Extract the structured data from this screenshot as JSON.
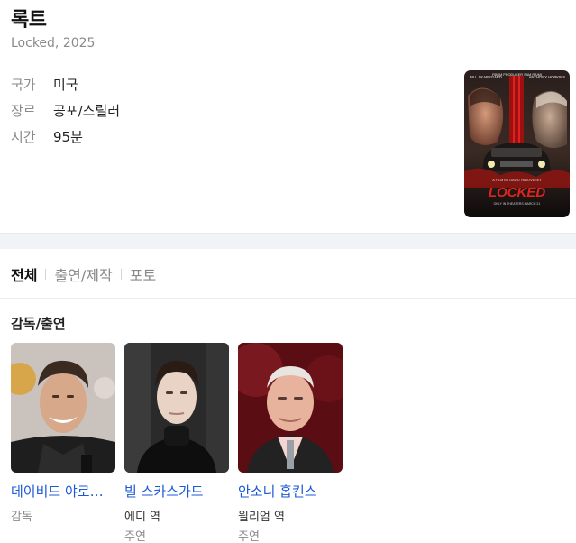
{
  "movie": {
    "title": "록트",
    "subtitle": "Locked, 2025",
    "info": [
      {
        "key": "국가",
        "value": "미국"
      },
      {
        "key": "장르",
        "value": "공포/스릴러"
      },
      {
        "key": "시간",
        "value": "95분"
      }
    ],
    "poster": {
      "big_title": "LOCKED",
      "credit_left": "BILL SKARSGÅRD",
      "credit_center": "FROM PRODUCER SAM RAIMI",
      "credit_right": "ANTHONY HOPKINS",
      "director_line": "A FILM BY DAVID YAROVESKY",
      "tagline": "ONLY IN THEATERS MARCH 21"
    }
  },
  "tabs": [
    {
      "label": "전체",
      "active": true
    },
    {
      "label": "출연/제작",
      "active": false
    },
    {
      "label": "포토",
      "active": false
    }
  ],
  "section": {
    "title": "감독/출연"
  },
  "cast": [
    {
      "name": "데이비드 야로베스키",
      "role": "감독",
      "kind": ""
    },
    {
      "name": "빌 스카스가드",
      "role": "에디 역",
      "kind": "주연"
    },
    {
      "name": "안소니 홉킨스",
      "role": "윌리엄 역",
      "kind": "주연"
    }
  ]
}
